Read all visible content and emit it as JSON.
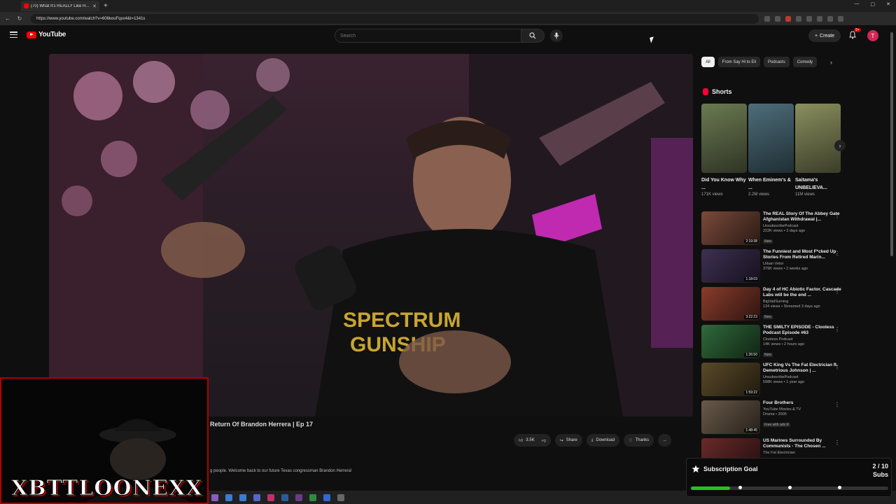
{
  "browser": {
    "tab_title": "(70) What It's REALLY Like H...",
    "url": "https://www.youtube.com/watch?v=606kouFqxx4&t=1341s",
    "window_controls": [
      "—",
      "▢",
      "✕"
    ]
  },
  "header": {
    "logo_text": "YouTube",
    "search_placeholder": "Search",
    "create_label": "Create",
    "notifications_badge": "9+",
    "avatar_letter": "T"
  },
  "video": {
    "title": "Return Of Brandon Herrera | Ep 17",
    "like_count": "3.5K",
    "share_label": "Share",
    "download_label": "Download",
    "thanks_label": "Thanks",
    "more_label": "...",
    "description": "g people. Welcome back to our future Texas congressman Brandon Herrera!"
  },
  "filters": {
    "chips": [
      {
        "label": "All",
        "active": true
      },
      {
        "label": "From Say Hi to Eli",
        "active": false
      },
      {
        "label": "Podcasts",
        "active": false
      },
      {
        "label": "Comedy",
        "active": false
      }
    ]
  },
  "shorts": {
    "heading": "Shorts",
    "items": [
      {
        "title": "Did You Know Why ...",
        "views": "171K views",
        "color": "#6b7a52"
      },
      {
        "title": "When Eminem's & ...",
        "views": "2.2M views",
        "color": "#4e6d7a"
      },
      {
        "title": "Saitama's UNBELIEVA...",
        "views": "11M views",
        "color": "#8a8f5e"
      }
    ]
  },
  "recommendations": [
    {
      "title": "The REAL Story Of The Abbey Gate Afghanistan Withdrawal |...",
      "channel": "UnsubscribePodcast",
      "meta": "222K views • 3 days ago",
      "badge": "New",
      "duration": "2:19:38",
      "color": "#7a4a3a"
    },
    {
      "title": "The Funniest and Most F*cked Up Stories From Retired Marin...",
      "channel": "Urban Vetor",
      "meta": "379K views • 2 weeks ago",
      "badge": "",
      "duration": "1:18:03",
      "color": "#3e3052"
    },
    {
      "title": "Day 4 of HC Abiotic Factor. Cascade Labs will be the end ...",
      "channel": "BigVadSurning",
      "meta": "134 views • Streamed 3 days ago",
      "badge": "New",
      "duration": "3:22:23",
      "color": "#8a3c2b"
    },
    {
      "title": "THE SMILTY EPISODE - Clooless Podcast Episode #63",
      "channel": "Clooless Podcast",
      "meta": "14K views • 2 hours ago",
      "badge": "New",
      "duration": "1:26:50",
      "color": "#2f6a3a"
    },
    {
      "title": "UFC King Vs The Fat Electrician ft. Demetrious Johnson | ...",
      "channel": "UnsubscribePodcast",
      "meta": "598K views • 1 year ago",
      "badge": "",
      "duration": "1:59:22",
      "color": "#5a4a2a"
    },
    {
      "title": "Four Brothers",
      "channel": "YouTube Movies & TV",
      "meta": "Drama • 2005",
      "badge": "Free with ads  R",
      "duration": "1:48:45",
      "color": "#6a5a4a"
    },
    {
      "title": "US Marines Surrounded By Communists - The Chosen ...",
      "channel": "The Fat Electrician",
      "meta": "",
      "badge": "",
      "duration": "",
      "color": "#6a2a2a"
    }
  ],
  "overlay": {
    "channel_text": "XBTTLOONEXX"
  },
  "goal": {
    "title": "Subscription Goal",
    "count": "2 / 10",
    "unit": "Subs",
    "progress": 0.2,
    "accent": "#26c21c"
  }
}
